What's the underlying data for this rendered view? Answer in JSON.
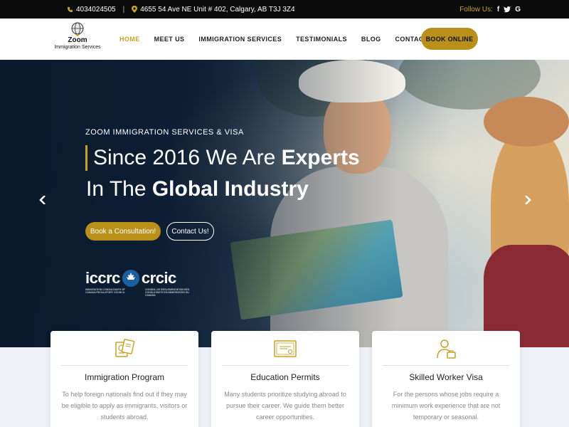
{
  "topbar": {
    "phone": "4034024505",
    "separator": "|",
    "address": "4655 54 Ave NE Unit # 402, Calgary, AB T3J 3Z4",
    "follow_label": "Follow Us:",
    "social": [
      "f",
      "t",
      "G"
    ]
  },
  "header": {
    "logo_name": "Zoom",
    "logo_sub": "Immigration Services",
    "nav": [
      "HOME",
      "MEET US",
      "IMMIGRATION SERVICES",
      "TESTIMONIALS",
      "BLOG",
      "CONTACT US"
    ],
    "book_label": "BOOK ONLINE"
  },
  "hero": {
    "kicker": "ZOOM IMMIGRATION SERVICES & VISA",
    "line1_plain": "Since 2016 We Are ",
    "line1_bold": "Experts",
    "line2_plain": "In The ",
    "line2_bold": "Global Industry",
    "consult_label": "Book a Consultation!",
    "contact_label": "Contact Us!",
    "badge_left": "iccrc",
    "badge_right": "crcic",
    "badge_small_left": "IMMIGRATION CONSULTANTS OF CANADA REGULATORY COUNCIL",
    "badge_small_right": "CONSEIL DE RÉGLEMENTATION DES CONSULTANTS EN IMMIGRATION DU CANADA"
  },
  "cards": [
    {
      "title": "Immigration Program",
      "desc": "To help foreign nationals find out if they may be eligible to apply as immigrants, visitors or students abroad."
    },
    {
      "title": "Education Permits",
      "desc": "Many students prioritize studying abroad to pursue their career. We guide them better career opportunities."
    },
    {
      "title": "Skilled Worker Visa",
      "desc": "For the persons whose jobs require a minimum work experience that are not temporary or seasonal."
    }
  ],
  "colors": {
    "accent": "#c9a227",
    "button": "#b8901a",
    "topbar": "#0b0b0b"
  }
}
